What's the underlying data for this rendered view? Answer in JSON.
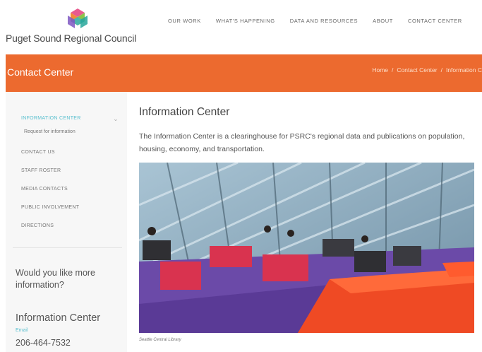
{
  "header": {
    "logo_text": "Puget Sound Regional Council",
    "nav": [
      "OUR WORK",
      "WHAT'S HAPPENING",
      "DATA AND RESOURCES",
      "ABOUT",
      "CONTACT CENTER"
    ]
  },
  "banner": {
    "title": "Contact Center",
    "breadcrumb": [
      "Home",
      "Contact Center",
      "Information C"
    ]
  },
  "sidebar": {
    "active_item": "INFORMATION CENTER",
    "sub_item": "Request for information",
    "items": [
      "CONTACT US",
      "STAFF ROSTER",
      "MEDIA CONTACTS",
      "PUBLIC INVOLVEMENT",
      "DIRECTIONS"
    ],
    "question": "Would you like more information?",
    "info_title": "Information Center",
    "email_label": "Email",
    "phone": "206-464-7532"
  },
  "main": {
    "title": "Information Center",
    "description": "The Information Center is a clearinghouse for PSRC's regional data and publications on population, housing, economy, and transportation.",
    "photo_caption": "Seattle Central Library"
  },
  "colors": {
    "brand_orange": "#ec6a2f",
    "accent_teal": "#5bc0cf",
    "sidebar_bg": "#f7f7f7"
  }
}
